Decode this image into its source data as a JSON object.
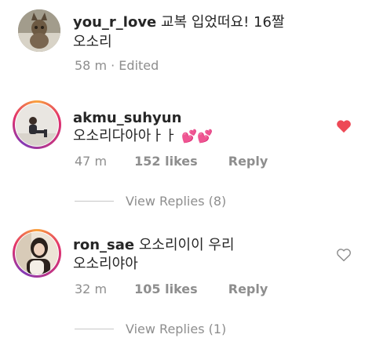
{
  "post": {
    "username": "you_r_love",
    "text_line1": "교복 입었떠요! 16짤",
    "text_line2": "오소리",
    "time": "58 m",
    "edited": "· Edited"
  },
  "comments": [
    {
      "username": "akmu_suhyun",
      "text": "오소리다아아ㅏㅏ",
      "emoji": "💕💕",
      "time": "47 m",
      "likes": "152 likes",
      "reply": "Reply",
      "liked": true,
      "view_replies": "View Replies (8)"
    },
    {
      "username": "ron_sae",
      "text_line1": "오소리이이 우리",
      "text_line2": "오소리야아",
      "time": "32 m",
      "likes": "105 likes",
      "reply": "Reply",
      "liked": false,
      "view_replies": "View Replies (1)"
    }
  ],
  "colors": {
    "heart_filled": "#ed4956",
    "heart_outline": "#8e8e8e",
    "muted_text": "#8e8e8e"
  }
}
